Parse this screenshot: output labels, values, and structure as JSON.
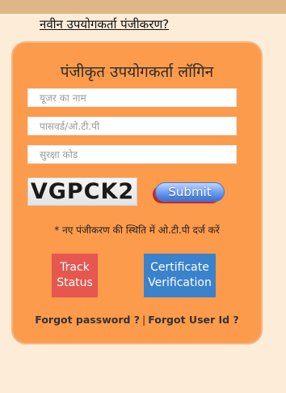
{
  "header": {
    "new_registration_link": "नवीन उपयोगकर्ता पंजीकरण?"
  },
  "login": {
    "title": "पंजीकृत उपयोगकर्ता लॉगिन",
    "username_placeholder": "यूजर का नाम",
    "password_placeholder": "पासवर्ड/ओ.टी.पी",
    "security_code_placeholder": "सुरक्षा कोड",
    "captcha_text": "VGPCK2",
    "submit_label": "Submit",
    "note": "* नए पंजीकरण की स्थिति में ओ.टी.पी दर्ज करें",
    "track_status_label": "Track\nStatus",
    "certificate_verification_label": "Certificate\nVerification",
    "forgot_password_label": "Forgot password ?",
    "separator": "|",
    "forgot_userid_label": "Forgot User Id ?"
  },
  "colors": {
    "page_bg": "#fdecd8",
    "top_bar": "#dfb787",
    "card_bg": "#fd9b4c",
    "track_button": "#e5574f",
    "certificate_button": "#3a82cc"
  }
}
